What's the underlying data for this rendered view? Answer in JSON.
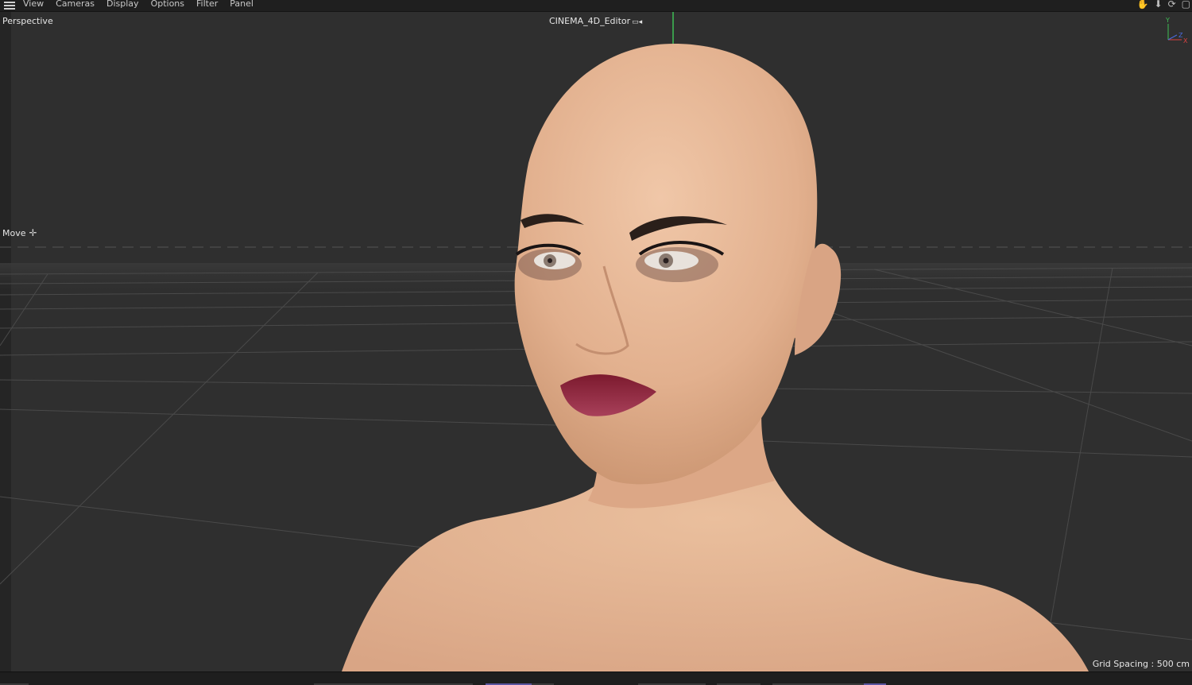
{
  "menubar": {
    "items": [
      "View",
      "Cameras",
      "Display",
      "Options",
      "Filter",
      "Panel"
    ],
    "icons": [
      "hand-icon",
      "arrow-down-icon",
      "rotate-icon",
      "maximize-icon"
    ]
  },
  "viewport": {
    "view_name": "Perspective",
    "camera_name": "CINEMA_4D_Editor",
    "active_tool": "Move",
    "grid_spacing": "Grid Spacing : 500 cm",
    "axis": {
      "y": "Y",
      "z": "Z",
      "x": "X"
    }
  },
  "colors": {
    "background": "#2f2f2f",
    "menubar": "#1f1f1f",
    "axis_y": "#3fbf55",
    "axis_x": "#d84242",
    "axis_z": "#4a6be0",
    "skin": "#e6b897",
    "lips": "#8a1f34"
  }
}
